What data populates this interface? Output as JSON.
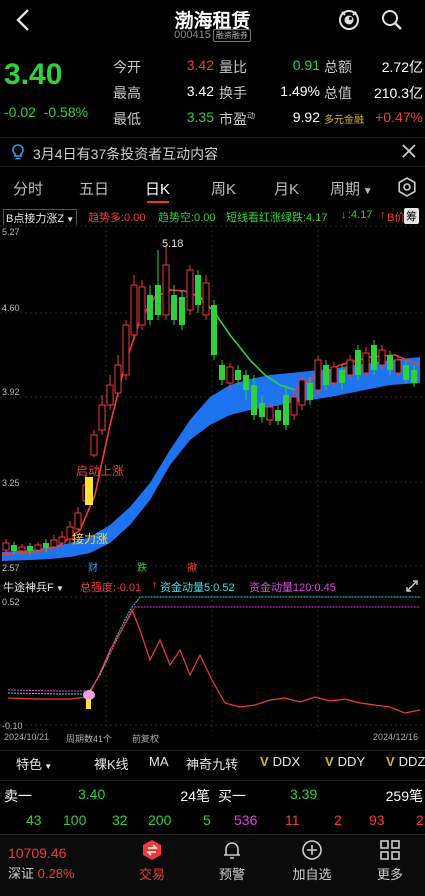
{
  "header": {
    "title": "渤海租赁",
    "code": "000415",
    "badge": "融资融券"
  },
  "quote": {
    "price": "3.40",
    "change": "-0.02",
    "change_pct": "-0.58%",
    "rows": [
      [
        {
          "label": "今开",
          "value": "3.42"
        },
        {
          "label": "量比",
          "value": "0.91"
        },
        {
          "label": "总额",
          "value": "2.72亿"
        }
      ],
      [
        {
          "label": "最高",
          "value": "3.42"
        },
        {
          "label": "换手",
          "value": "1.49%"
        },
        {
          "label": "总值",
          "value": "210.3亿"
        }
      ],
      [
        {
          "label": "最低",
          "value": "3.35"
        },
        {
          "label": "市盈动",
          "value": "9.92"
        },
        {
          "label": "多元金融",
          "value": "+0.47%"
        }
      ]
    ]
  },
  "notice": {
    "text": "3月4日有37条投资者互动内容"
  },
  "tabs": [
    {
      "label": "分时"
    },
    {
      "label": "五日"
    },
    {
      "label": "日K"
    },
    {
      "label": "周K"
    },
    {
      "label": "月K"
    },
    {
      "label": "周期"
    }
  ],
  "indicator": {
    "name": "B点接力涨Z",
    "items": [
      {
        "label": "趋势多:0.00",
        "color": "#f03a3a"
      },
      {
        "label": "趋势空:0.00",
        "color": "#2ed13a"
      },
      {
        "label": "短线看红涨绿跌:4.17",
        "color": "#2ed13a"
      },
      {
        "label": "↓",
        "color": "#2ed13a"
      },
      {
        "label": ":4.17",
        "color": "#2ed13a"
      },
      {
        "label": "↑",
        "color": "#f03a3a"
      },
      {
        "label": "B价",
        "color": "#f03a3a"
      }
    ],
    "more": "筹"
  },
  "chart": {
    "y_labels": [
      "5.27",
      "4.60",
      "3.92",
      "3.25",
      "2.57"
    ],
    "max_label": "5.18",
    "signal_up": "启动上涨",
    "signal_relay": "接力涨",
    "tags": [
      "财",
      "跌",
      "撤"
    ]
  },
  "sub_indicator": {
    "name": "牛途神兵F",
    "items": [
      {
        "label": "总强度:-0.01",
        "color": "#f03a3a"
      },
      {
        "label": "↑",
        "color": "#f03a3a"
      },
      {
        "label": "资金动量5:0.52",
        "color": "#36e0e0"
      },
      {
        "label": "资金动量120:0.45",
        "color": "#e040e0"
      }
    ],
    "y_top": "0.52",
    "y_bottom": "-0.10"
  },
  "dates": {
    "start": "2024/10/21",
    "period": "周期数41个",
    "adjust": "前复权",
    "end": "2024/12/16"
  },
  "toolbar": [
    {
      "label": "特色",
      "dropdown": true
    },
    {
      "label": "裸K线"
    },
    {
      "label": "MA"
    },
    {
      "label": "神奇九转"
    },
    {
      "label": "DDX",
      "v": true
    },
    {
      "label": "DDY",
      "v": true
    },
    {
      "label": "DDZ",
      "v": true
    }
  ],
  "orderbook": {
    "sell_label": "卖一",
    "sell_price": "3.40",
    "sell_count": "24笔",
    "buy_label": "买一",
    "buy_price": "3.39",
    "buy_count": "259笔",
    "sell_vols": [
      "43",
      "100",
      "32",
      "200",
      "5"
    ],
    "buy_vols": [
      "536",
      "11",
      "2",
      "93",
      "2"
    ]
  },
  "nav": {
    "index_value": "10709.46",
    "index_name": "深证",
    "index_pct": "0.28%",
    "items": [
      {
        "label": "交易",
        "icon": "trade-icon"
      },
      {
        "label": "预警",
        "icon": "bell-icon"
      },
      {
        "label": "加自选",
        "icon": "plus-circle-icon"
      },
      {
        "label": "更多",
        "icon": "grid-icon"
      }
    ]
  },
  "colors": {
    "up": "#f03a3a",
    "down": "#2ed13a",
    "band": "#1e74f0",
    "accent": "#e33"
  }
}
